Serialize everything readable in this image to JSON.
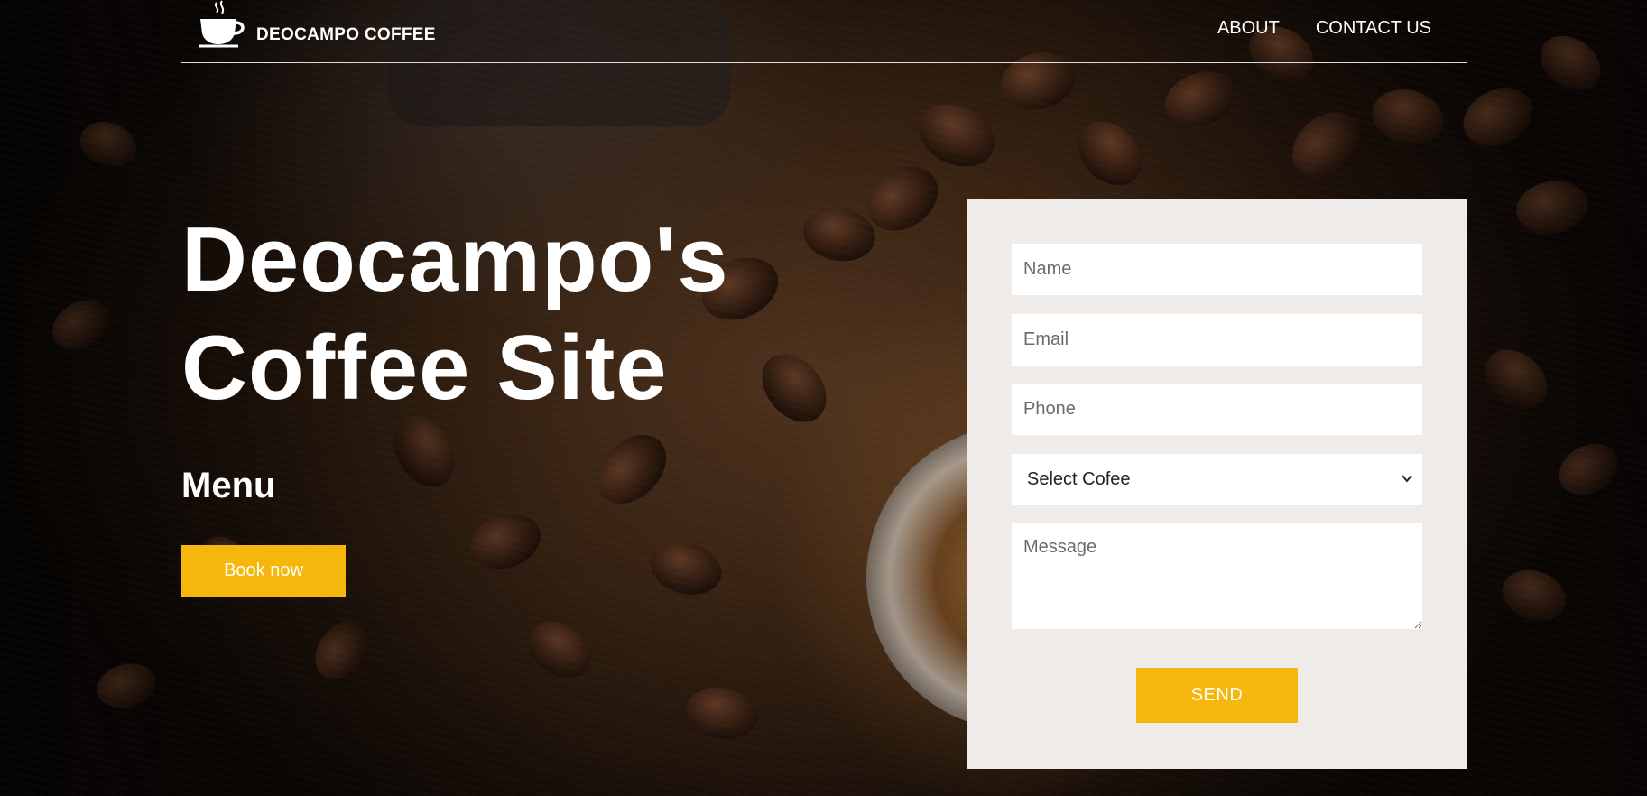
{
  "brand": {
    "name": "DEOCAMPO COFFEE",
    "logo_icon": "coffee-cup-icon"
  },
  "nav": {
    "items": [
      {
        "label": "ABOUT"
      },
      {
        "label": "CONTACT US"
      }
    ]
  },
  "hero": {
    "title": "Deocampo's Coffee Site",
    "subtitle": "Menu",
    "cta_label": "Book now"
  },
  "form": {
    "name_placeholder": "Name",
    "email_placeholder": "Email",
    "phone_placeholder": "Phone",
    "select_value": "Select Cofee",
    "message_placeholder": "Message",
    "submit_label": "SEND"
  },
  "colors": {
    "accent": "#f5b70b",
    "card_background": "#efebe8",
    "text_light": "#ffffff"
  }
}
